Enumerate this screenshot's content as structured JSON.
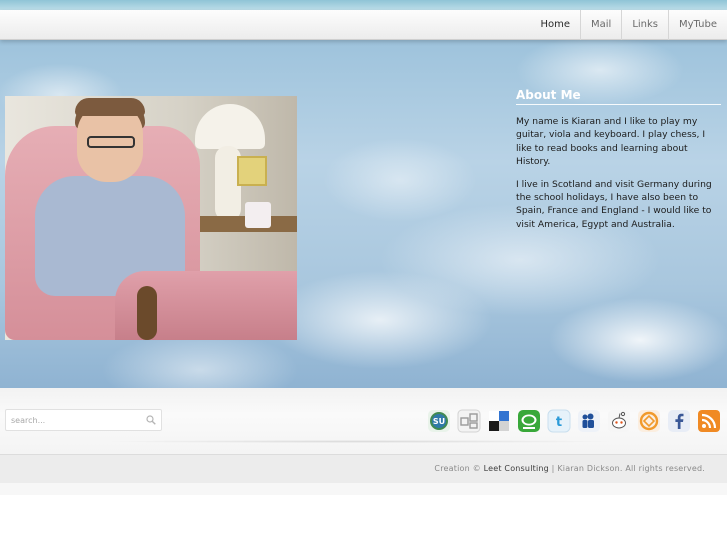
{
  "nav": {
    "items": [
      "Home",
      "Mail",
      "Links",
      "MyTube"
    ],
    "active": "Home"
  },
  "about": {
    "title": "About Me",
    "paragraphs": [
      "My name is Kiaran and I like to play my guitar, viola and keyboard.  I play chess, I like to read books and learning about History.",
      "I live in Scotland and visit Germany during the school holidays, I have also been to Spain, France and England - I would like to visit America, Egypt and Australia."
    ]
  },
  "search": {
    "placeholder": "search..."
  },
  "social": [
    "stumbleupon-icon",
    "digg-icon",
    "delicious-icon",
    "technorati-icon",
    "twitter-icon",
    "myspace-icon",
    "reddit-icon",
    "mixx-icon",
    "facebook-icon",
    "rss-icon"
  ],
  "footer": {
    "prefix": "Creation ©",
    "company": "Leet Consulting",
    "separator": "|",
    "rights": "Kiaran Dickson. All rights reserved."
  },
  "colors": {
    "sky": "#a9c7de",
    "nav_bg": "#f5f5f5",
    "footer_bg": "#ececec"
  }
}
